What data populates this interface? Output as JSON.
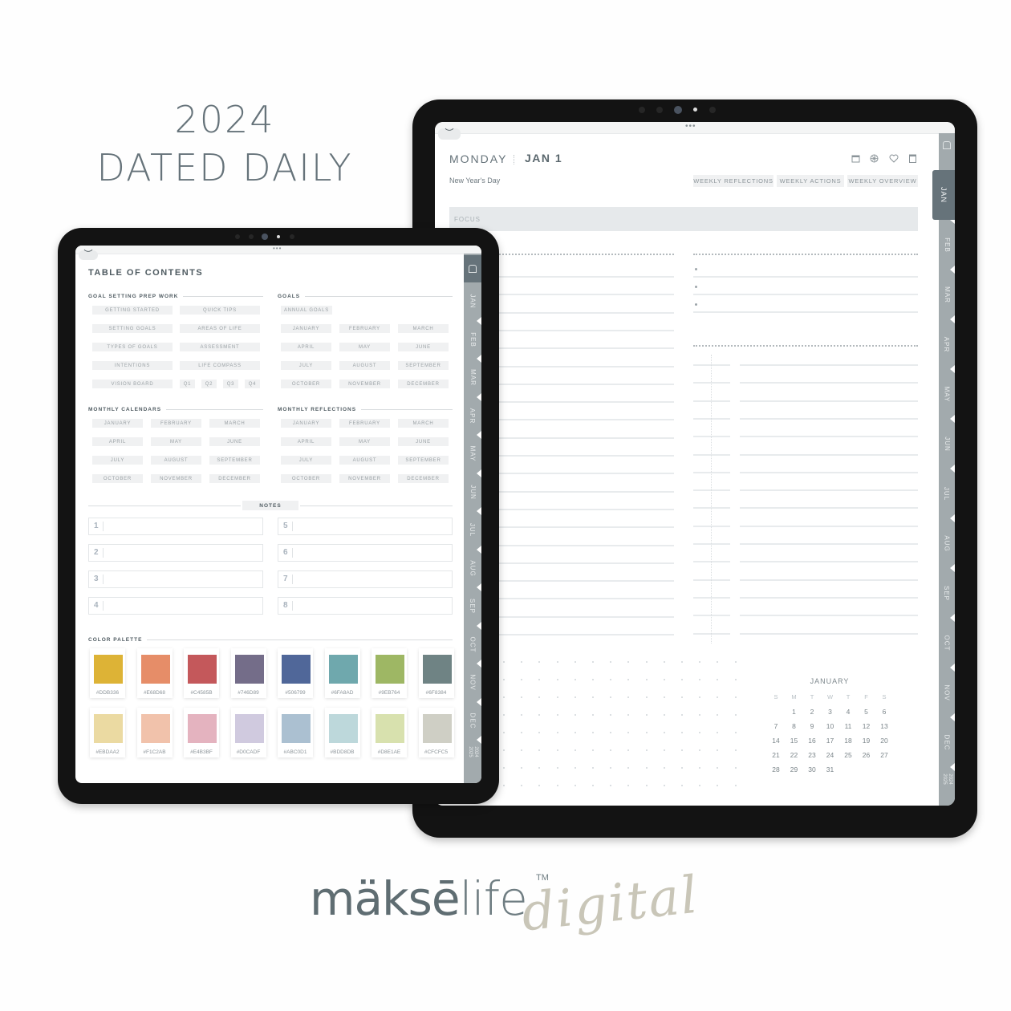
{
  "headline": {
    "year": "2024",
    "title": "DATED DAILY"
  },
  "month_tabs": [
    "JAN",
    "FEB",
    "MAR",
    "APR",
    "MAY",
    "JUN",
    "JUL",
    "AUG",
    "SEP",
    "OCT",
    "NOV",
    "DEC"
  ],
  "year_tab": "2024 2025",
  "toc": {
    "title": "TABLE OF CONTENTS",
    "goal_prep": {
      "heading": "GOAL SETTING PREP WORK",
      "items": [
        "GETTING STARTED",
        "QUICK TIPS",
        "SETTING GOALS",
        "AREAS OF LIFE",
        "TYPES OF GOALS",
        "ASSESSMENT",
        "INTENTIONS",
        "LIFE COMPASS",
        "VISION BOARD"
      ],
      "quarters": [
        "Q1",
        "Q2",
        "Q3",
        "Q4"
      ]
    },
    "goals": {
      "heading": "GOALS",
      "annual": "ANNUAL GOALS",
      "months": [
        "JANUARY",
        "FEBRUARY",
        "MARCH",
        "APRIL",
        "MAY",
        "JUNE",
        "JULY",
        "AUGUST",
        "SEPTEMBER",
        "OCTOBER",
        "NOVEMBER",
        "DECEMBER"
      ]
    },
    "monthly_calendars": {
      "heading": "MONTHLY CALENDARS",
      "months": [
        "JANUARY",
        "FEBRUARY",
        "MARCH",
        "APRIL",
        "MAY",
        "JUNE",
        "JULY",
        "AUGUST",
        "SEPTEMBER",
        "OCTOBER",
        "NOVEMBER",
        "DECEMBER"
      ]
    },
    "monthly_reflections": {
      "heading": "MONTHLY REFLECTIONS",
      "months": [
        "JANUARY",
        "FEBRUARY",
        "MARCH",
        "APRIL",
        "MAY",
        "JUNE",
        "JULY",
        "AUGUST",
        "SEPTEMBER",
        "OCTOBER",
        "NOVEMBER",
        "DECEMBER"
      ]
    },
    "notes": {
      "heading": "NOTES",
      "numbers": [
        "1",
        "2",
        "3",
        "4",
        "5",
        "6",
        "7",
        "8"
      ]
    },
    "palette": {
      "heading": "COLOR PALETTE",
      "colors": [
        {
          "hex": "#DDB336",
          "label": "#DDB336"
        },
        {
          "hex": "#E68D68",
          "label": "#E68D68"
        },
        {
          "hex": "#C4585B",
          "label": "#C4585B"
        },
        {
          "hex": "#746D89",
          "label": "#746D89"
        },
        {
          "hex": "#506799",
          "label": "#506799"
        },
        {
          "hex": "#6FA8AD",
          "label": "#6FA8AD"
        },
        {
          "hex": "#9EB764",
          "label": "#9EB764"
        },
        {
          "hex": "#6F8384",
          "label": "#6F8384"
        },
        {
          "hex": "#EBDAA2",
          "label": "#EBDAA2"
        },
        {
          "hex": "#F1C2AB",
          "label": "#F1C2AB"
        },
        {
          "hex": "#E4B3BF",
          "label": "#E4B3BF"
        },
        {
          "hex": "#D0CADF",
          "label": "#D0CADF"
        },
        {
          "hex": "#ABC0D1",
          "label": "#ABC0D1"
        },
        {
          "hex": "#BDD8DB",
          "label": "#BDD8DB"
        },
        {
          "hex": "#D8E1AE",
          "label": "#D8E1AE"
        },
        {
          "hex": "#CFCFC5",
          "label": "#CFCFC5"
        }
      ]
    }
  },
  "daily": {
    "weekday": "MONDAY",
    "date": "JAN 1",
    "holiday": "New Year's Day",
    "icons": [
      "calendar-icon",
      "settings-wheel-icon",
      "heart-icon",
      "notebook-icon"
    ],
    "weekly_buttons": [
      "WEEKLY REFLECTIONS",
      "WEEKLY ACTIONS",
      "WEEKLY OVERVIEW"
    ],
    "focus_label": "FOCUS",
    "mini_calendar": {
      "month": "JANUARY",
      "weekdays": [
        "S",
        "M",
        "T",
        "W",
        "T",
        "F",
        "S"
      ],
      "first_weekday_index": 1,
      "days_in_month": 31
    }
  },
  "brand": {
    "name_bold": "mäksē",
    "name_light": "life",
    "tm": "TM",
    "script": "digital"
  },
  "colors": {
    "accent": "#66737A",
    "tab": "#A2AAAD",
    "pill": "#F0F1F2"
  }
}
